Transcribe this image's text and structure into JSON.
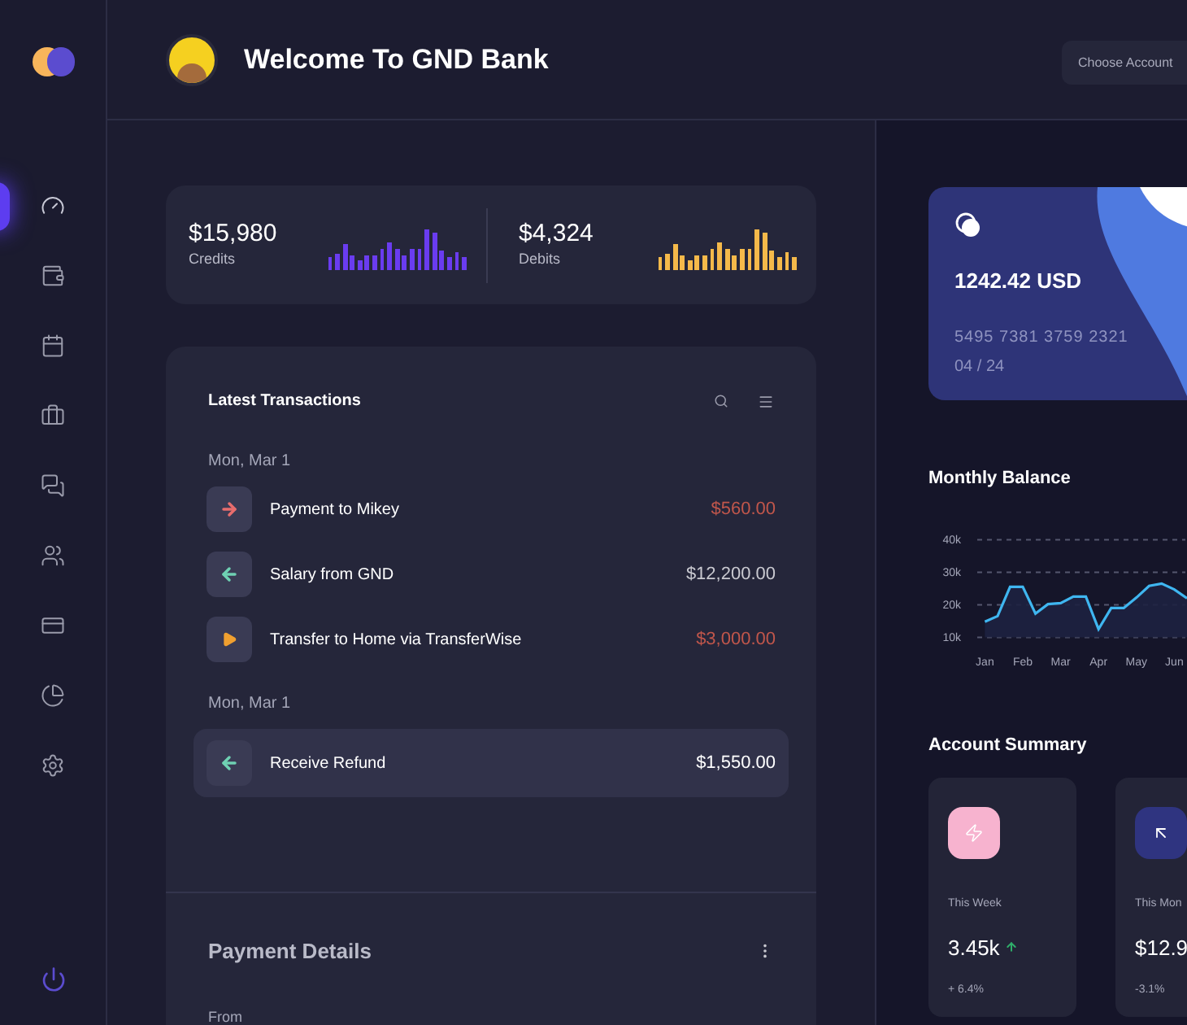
{
  "sidebar": {
    "items": [
      {
        "selected": true
      },
      {
        "selected": false
      },
      {
        "selected": false
      },
      {
        "selected": false
      },
      {
        "selected": false
      },
      {
        "selected": false
      },
      {
        "selected": false
      },
      {
        "selected": false
      },
      {
        "selected": false
      }
    ]
  },
  "header": {
    "title": "Welcome To GND Bank",
    "account_button": "Choose Account"
  },
  "stats": [
    {
      "value": "$15,980",
      "label": "Credits",
      "color": "#6a3cf0"
    },
    {
      "value": "$4,324",
      "label": "Debits",
      "color": "#f5b94a"
    }
  ],
  "transactions": {
    "title": "Latest Transactions",
    "groups": [
      {
        "date": "Mon, Mar 1",
        "items": [
          {
            "kind": "outgoing",
            "name": "Payment to Mikey",
            "amount": "$560.00",
            "selected": false
          },
          {
            "kind": "incoming",
            "name": "Salary from GND",
            "amount": "$12,200.00",
            "selected": false
          },
          {
            "kind": "transfer",
            "name": "Transfer to Home via TransferWise",
            "amount": "$3,000.00",
            "selected": false
          }
        ]
      },
      {
        "date": "Mon, Mar 1",
        "items": [
          {
            "kind": "incoming",
            "name": "Receive Refund",
            "amount": "$1,550.00",
            "selected": true
          }
        ]
      }
    ]
  },
  "payment_details": {
    "title": "Payment Details",
    "from_label": "From"
  },
  "card": {
    "balance": "1242.42 USD",
    "number": "5495 7381 3759 2321",
    "expiry": "04 / 24"
  },
  "monthly_balance": {
    "title": "Monthly Balance",
    "chart_data": {
      "type": "area",
      "ylim": [
        10,
        40
      ],
      "categories": [
        "Jan",
        null,
        null,
        "Feb",
        null,
        null,
        "Mar",
        null,
        null,
        "Apr",
        null,
        null,
        "May",
        null,
        null,
        "Jun",
        null
      ],
      "series": [
        {
          "color": "#3fb6f0",
          "values": [
            14.8,
            16.5,
            25.5,
            25.5,
            17.3,
            20.2,
            20.5,
            22.5,
            22.5,
            12.5,
            19,
            19,
            22.2,
            25.8,
            26.5,
            24.7,
            22
          ]
        }
      ],
      "yticks": [
        {
          "value": 10,
          "label": "10k"
        },
        {
          "value": 20,
          "label": "20k"
        },
        {
          "value": 30,
          "label": "30k"
        },
        {
          "value": 40,
          "label": "40k"
        }
      ]
    }
  },
  "account_summary": {
    "title": "Account Summary",
    "cards": [
      {
        "color": "#f7b3cf",
        "label": "This Week",
        "value": "3.45k",
        "rising": true,
        "change": "+ 6.4%"
      },
      {
        "color": "#2f3480",
        "label": "This Mon",
        "value": "$12.9",
        "change": "-3.1%"
      }
    ]
  }
}
